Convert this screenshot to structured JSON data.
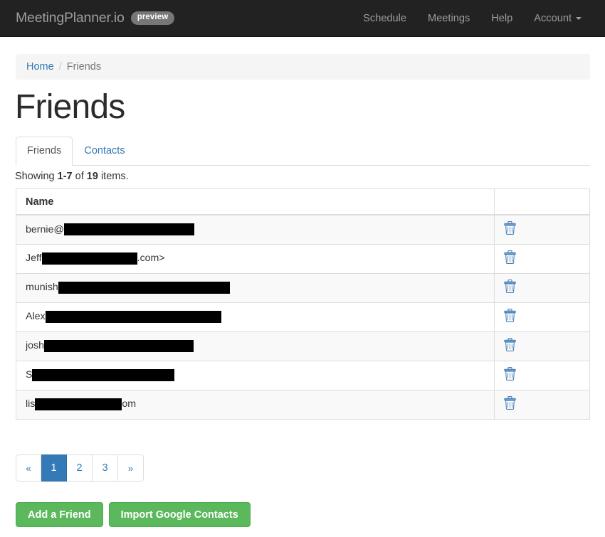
{
  "navbar": {
    "brand": "MeetingPlanner.io",
    "preview_badge": "preview",
    "links": [
      {
        "label": "Schedule",
        "name": "nav-link-schedule"
      },
      {
        "label": "Meetings",
        "name": "nav-link-meetings"
      },
      {
        "label": "Help",
        "name": "nav-link-help"
      },
      {
        "label": "Account",
        "name": "nav-link-account",
        "has_caret": true
      }
    ],
    "background_color": "#222222",
    "text_color": "#9d9d9d"
  },
  "breadcrumb": {
    "home_label": "Home",
    "separator": "/",
    "current_label": "Friends"
  },
  "page_title": "Friends",
  "tabs": [
    {
      "label": "Friends",
      "active": true
    },
    {
      "label": "Contacts",
      "active": false
    }
  ],
  "summary": {
    "prefix": "Showing ",
    "range": "1-7",
    "middle": " of ",
    "total": "19",
    "suffix": " items."
  },
  "table": {
    "columns": [
      "Name",
      ""
    ],
    "delete_icon": "trash-icon",
    "rows": [
      {
        "prefix": "bernie@",
        "redact_width": 183,
        "suffix": ""
      },
      {
        "prefix": "Jeff ",
        "redact_width": 134,
        "suffix": ".com>"
      },
      {
        "prefix": "munish",
        "redact_width": 241,
        "suffix": ""
      },
      {
        "prefix": "Alex ",
        "redact_width": 247,
        "suffix": ""
      },
      {
        "prefix": "josh",
        "redact_width": 210,
        "suffix": ""
      },
      {
        "prefix": "S",
        "redact_width": 200,
        "suffix": ""
      },
      {
        "prefix": "lis",
        "redact_width": 122,
        "suffix": "om"
      }
    ]
  },
  "pagination": {
    "items": [
      {
        "label": "«",
        "active": false,
        "name": "pagination-prev"
      },
      {
        "label": "1",
        "active": true,
        "name": "pagination-page-1"
      },
      {
        "label": "2",
        "active": false,
        "name": "pagination-page-2"
      },
      {
        "label": "3",
        "active": false,
        "name": "pagination-page-3"
      },
      {
        "label": "»",
        "active": false,
        "name": "pagination-next"
      }
    ]
  },
  "actions": {
    "add_friend_label": "Add a Friend",
    "import_contacts_label": "Import Google Contacts",
    "button_color": "#5cb85c"
  },
  "colors": {
    "link": "#337ab7",
    "navbar_bg": "#222222",
    "breadcrumb_bg": "#f5f5f5",
    "border": "#dddddd",
    "stripe": "#f9f9f9"
  }
}
